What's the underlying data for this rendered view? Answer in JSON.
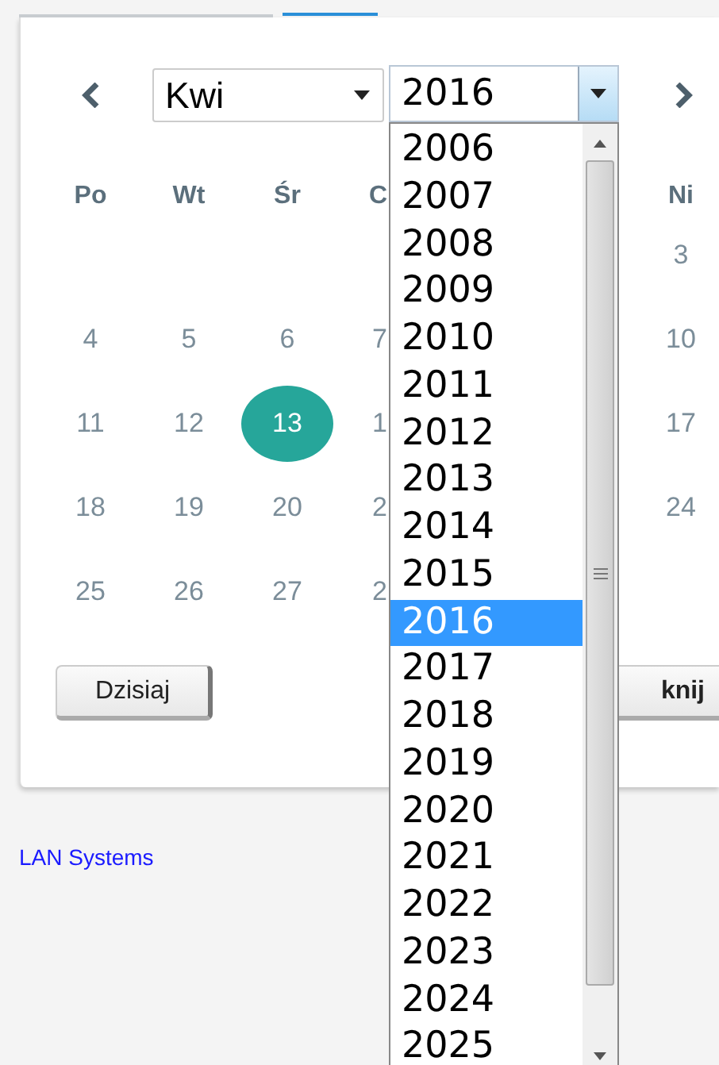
{
  "month_select": {
    "value": "Kwi"
  },
  "year_select": {
    "value": "2016",
    "open": true
  },
  "weekdays": {
    "po": "Po",
    "wt": "Wt",
    "sr": "Śr",
    "cz": "C",
    "ni": "Ni"
  },
  "weeks": [
    {
      "ni": {
        "label": "3",
        "selected": false
      }
    },
    {
      "po": {
        "label": "4",
        "selected": false
      },
      "wt": {
        "label": "5",
        "selected": false
      },
      "sr": {
        "label": "6",
        "selected": false
      },
      "cz": {
        "label": "7",
        "selected": false
      },
      "ni": {
        "label": "10",
        "selected": false
      }
    },
    {
      "po": {
        "label": "11",
        "selected": false
      },
      "wt": {
        "label": "12",
        "selected": false
      },
      "sr": {
        "label": "13",
        "selected": true
      },
      "cz": {
        "label": "1",
        "selected": false
      },
      "ni": {
        "label": "17",
        "selected": false
      }
    },
    {
      "po": {
        "label": "18",
        "selected": false
      },
      "wt": {
        "label": "19",
        "selected": false
      },
      "sr": {
        "label": "20",
        "selected": false
      },
      "cz": {
        "label": "2",
        "selected": false
      },
      "ni": {
        "label": "24",
        "selected": false
      }
    },
    {
      "po": {
        "label": "25",
        "selected": false
      },
      "wt": {
        "label": "26",
        "selected": false
      },
      "sr": {
        "label": "27",
        "selected": false
      },
      "cz": {
        "label": "2",
        "selected": false
      }
    }
  ],
  "buttons": {
    "today": "Dzisiaj",
    "close": "knij"
  },
  "footer_link": "LAN Systems",
  "year_options": [
    {
      "label": "2006",
      "selected": false
    },
    {
      "label": "2007",
      "selected": false
    },
    {
      "label": "2008",
      "selected": false
    },
    {
      "label": "2009",
      "selected": false
    },
    {
      "label": "2010",
      "selected": false
    },
    {
      "label": "2011",
      "selected": false
    },
    {
      "label": "2012",
      "selected": false
    },
    {
      "label": "2013",
      "selected": false
    },
    {
      "label": "2014",
      "selected": false
    },
    {
      "label": "2015",
      "selected": false
    },
    {
      "label": "2016",
      "selected": true
    },
    {
      "label": "2017",
      "selected": false
    },
    {
      "label": "2018",
      "selected": false
    },
    {
      "label": "2019",
      "selected": false
    },
    {
      "label": "2020",
      "selected": false
    },
    {
      "label": "2021",
      "selected": false
    },
    {
      "label": "2022",
      "selected": false
    },
    {
      "label": "2023",
      "selected": false
    },
    {
      "label": "2024",
      "selected": false
    },
    {
      "label": "2025",
      "selected": false
    }
  ]
}
